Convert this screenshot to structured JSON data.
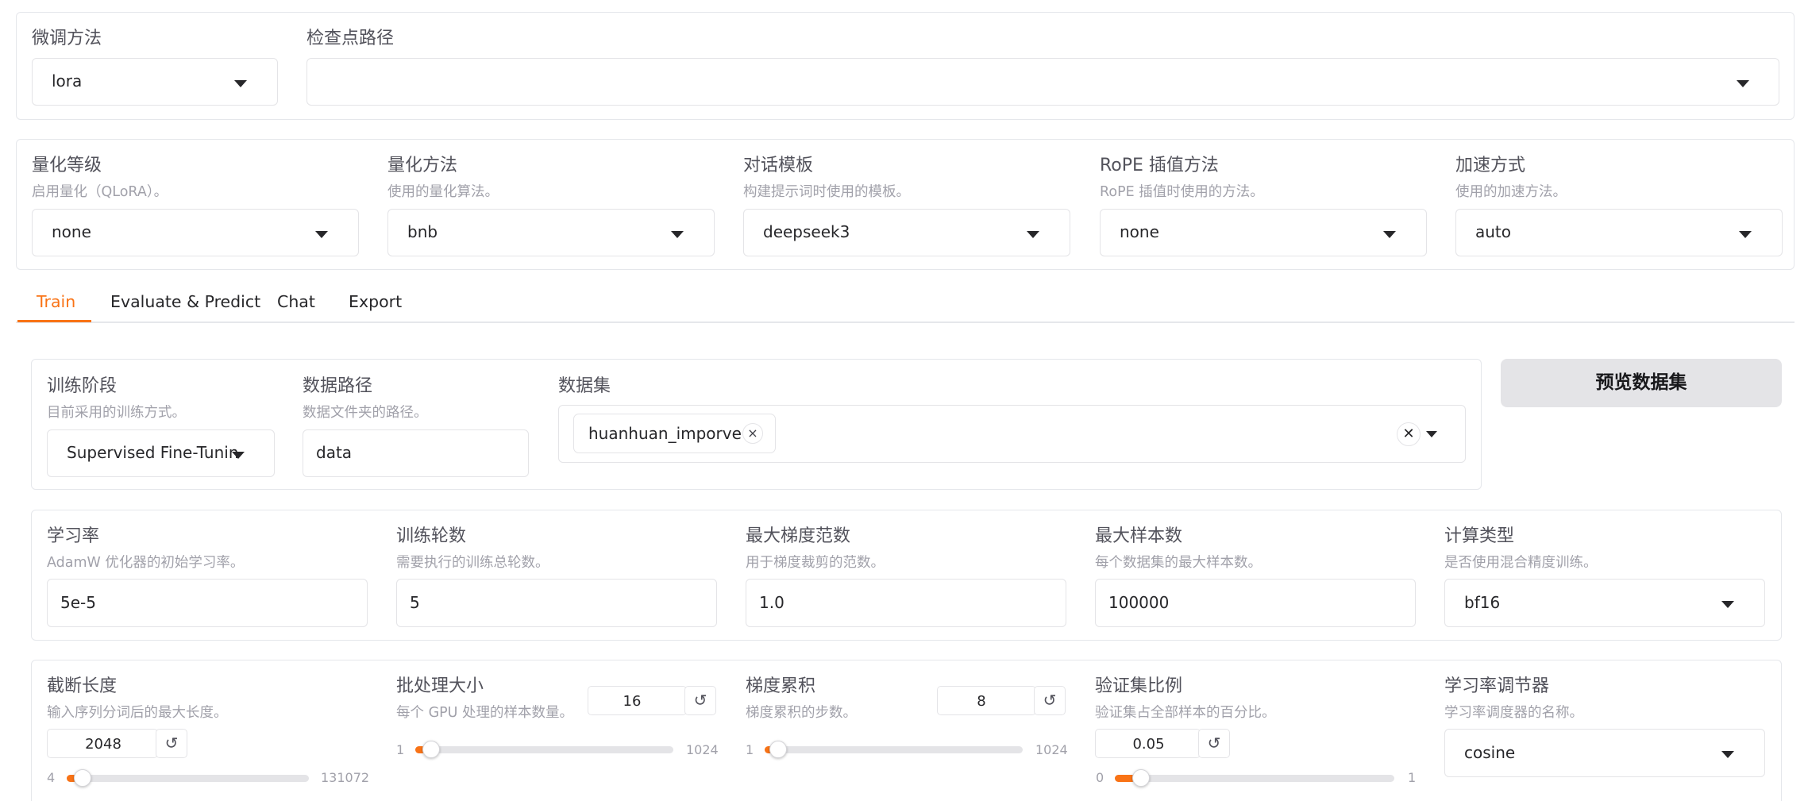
{
  "top": {
    "finetune": {
      "label": "微调方法",
      "value": "lora"
    },
    "checkpoint": {
      "label": "检查点路径",
      "value": ""
    }
  },
  "quant": {
    "level": {
      "label": "量化等级",
      "info": "启用量化（QLoRA）。",
      "value": "none"
    },
    "method": {
      "label": "量化方法",
      "info": "使用的量化算法。",
      "value": "bnb"
    },
    "template": {
      "label": "对话模板",
      "info": "构建提示词时使用的模板。",
      "value": "deepseek3"
    },
    "rope": {
      "label": "RoPE 插值方法",
      "info": "RoPE 插值时使用的方法。",
      "value": "none"
    },
    "booster": {
      "label": "加速方式",
      "info": "使用的加速方法。",
      "value": "auto"
    }
  },
  "tabs": [
    "Train",
    "Evaluate & Predict",
    "Chat",
    "Export"
  ],
  "train": {
    "stage": {
      "label": "训练阶段",
      "info": "目前采用的训练方式。",
      "value": "Supervised Fine-Tuning"
    },
    "dataset_dir": {
      "label": "数据路径",
      "info": "数据文件夹的路径。",
      "value": "data"
    },
    "dataset": {
      "label": "数据集",
      "tag": "huanhuan_imporve",
      "tag_close": "×",
      "clear": "✕"
    },
    "preview_button": "预览数据集",
    "lr": {
      "label": "学习率",
      "info": "AdamW 优化器的初始学习率。",
      "value": "5e-5"
    },
    "epochs": {
      "label": "训练轮数",
      "info": "需要执行的训练总轮数。",
      "value": "5"
    },
    "max_grad_norm": {
      "label": "最大梯度范数",
      "info": "用于梯度裁剪的范数。",
      "value": "1.0"
    },
    "max_samples": {
      "label": "最大样本数",
      "info": "每个数据集的最大样本数。",
      "value": "100000"
    },
    "compute_type": {
      "label": "计算类型",
      "info": "是否使用混合精度训练。",
      "value": "bf16"
    },
    "cutoff_len": {
      "label": "截断长度",
      "info": "输入序列分词后的最大长度。",
      "value": "2048",
      "min": "4",
      "max": "131072",
      "fraction": 0.0156
    },
    "batch_size": {
      "label": "批处理大小",
      "info": "每个 GPU 处理的样本数量。",
      "value": "16",
      "min": "1",
      "max": "1024",
      "fraction": 0.0147
    },
    "grad_accum": {
      "label": "梯度累积",
      "info": "梯度累积的步数。",
      "value": "8",
      "min": "1",
      "max": "1024",
      "fraction": 0.0068
    },
    "val_size": {
      "label": "验证集比例",
      "info": "验证集占全部样本的百分比。",
      "value": "0.05",
      "min": "0",
      "max": "1",
      "fraction": 0.05
    },
    "lr_scheduler": {
      "label": "学习率调节器",
      "info": "学习率调度器的名称。",
      "value": "cosine"
    },
    "reset_glyph": "↺"
  }
}
